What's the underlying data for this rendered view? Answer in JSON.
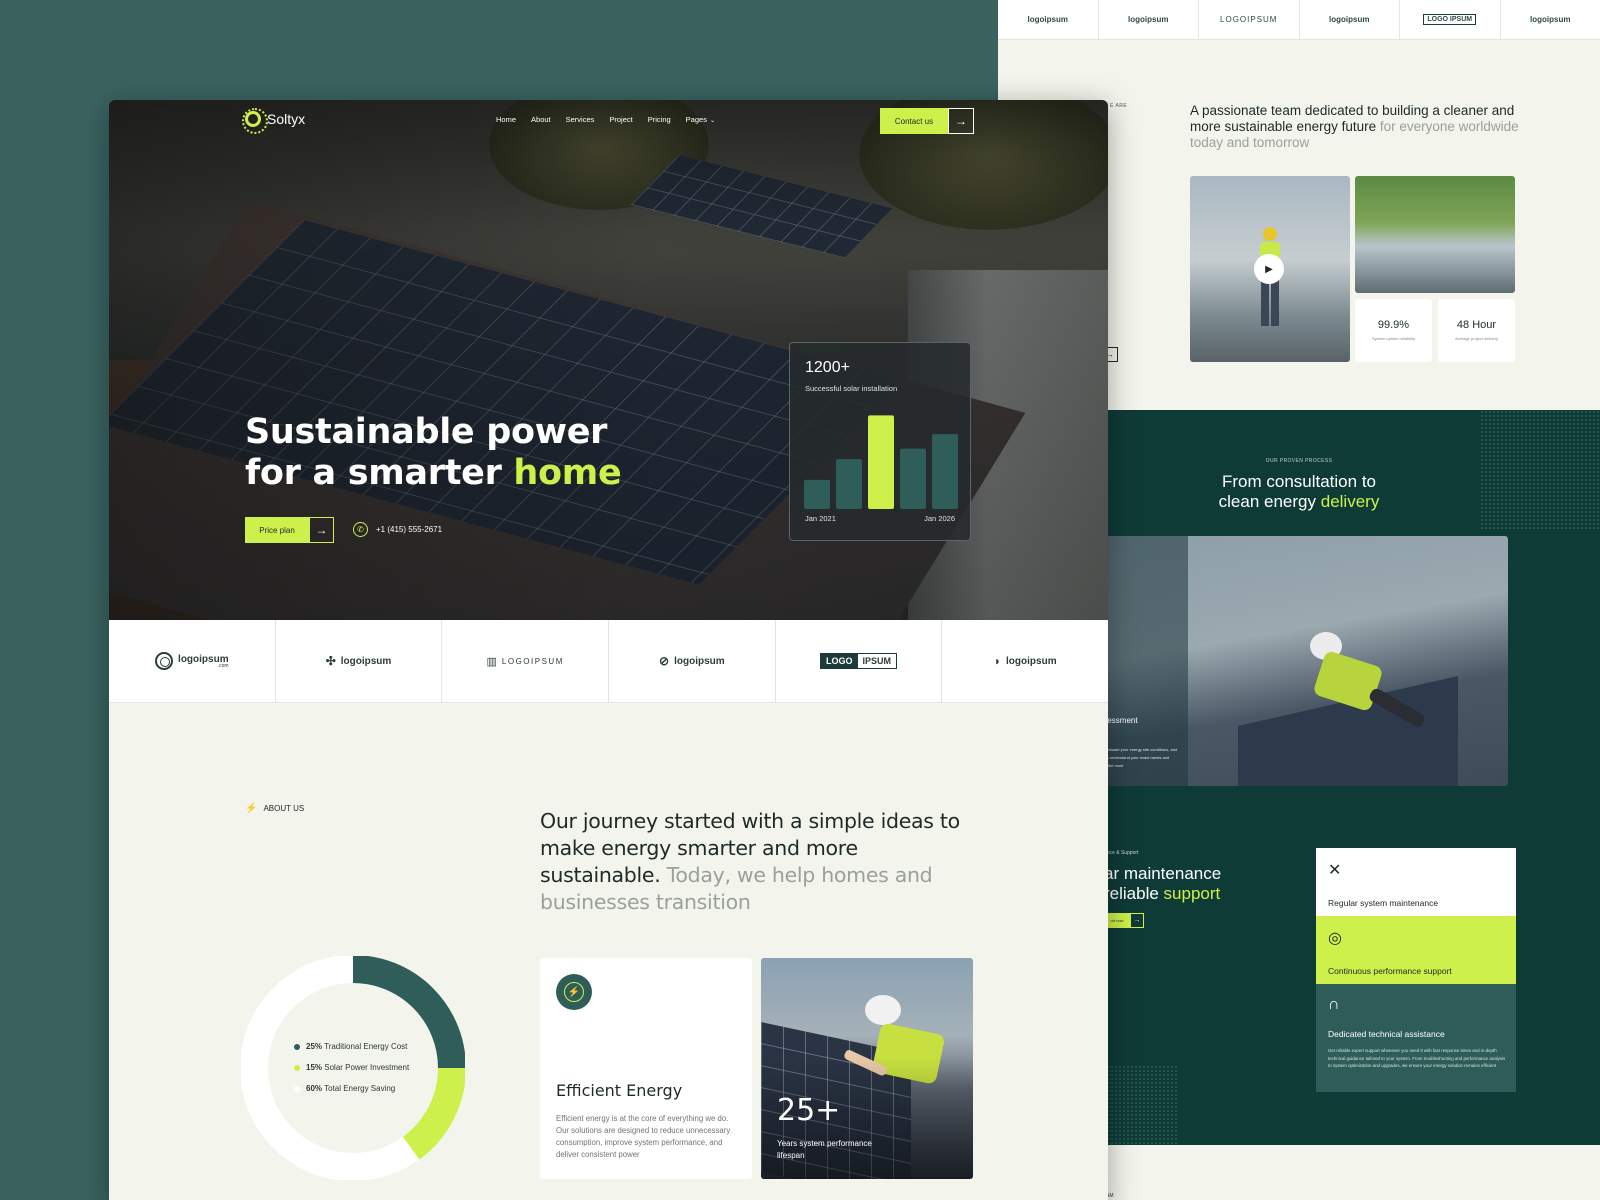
{
  "brand": {
    "name": "Soltyx",
    "accent": "#cdf04a",
    "primary_dark": "#0f3b37",
    "teal": "#2f5e5a"
  },
  "nav": {
    "items": [
      "Home",
      "About",
      "Services",
      "Project",
      "Pricing",
      "Pages"
    ],
    "contact_label": "Contact us"
  },
  "hero": {
    "title_line1": "Sustainable power",
    "title_line2_prefix": "for a smarter ",
    "title_highlight": "home",
    "price_button": "Price plan",
    "phone": "+1 (415) 555-2671"
  },
  "stat_card": {
    "value": "1200+",
    "label": "Successful solar installation",
    "start_label": "Jan 2021",
    "end_label": "Jan 2026"
  },
  "chart_data": {
    "type": "bar",
    "title": "1200+",
    "categories": [
      "1",
      "2",
      "3",
      "4",
      "5"
    ],
    "values": [
      28,
      48,
      90,
      58,
      72
    ],
    "ylim": [
      0,
      100
    ],
    "highlight_index": 2,
    "colors": {
      "bar": "#2f5e5a",
      "highlight": "#cdf04a"
    },
    "x_range_labels": [
      "Jan 2021",
      "Jan 2026"
    ]
  },
  "logos": [
    {
      "text": "logoipsum",
      "sub": ".com",
      "style": "ring"
    },
    {
      "text": "logoipsum",
      "sub": "",
      "style": "grid"
    },
    {
      "text": "LOGOIPSUM",
      "sub": "",
      "style": "thin"
    },
    {
      "text": "logoipsum",
      "sub": "",
      "style": "slash"
    },
    {
      "text": "LOGO",
      "text2": "IPSUM",
      "style": "boxed"
    },
    {
      "text": "logoipsum",
      "sub": "",
      "style": "d"
    }
  ],
  "about": {
    "caption": "ABOUT US",
    "text_strong": "Our journey started with a simple ideas to make energy smarter and more sustainable.",
    "text_muted": " Today, we help homes and businesses transition"
  },
  "donut": {
    "segments": [
      {
        "pct": "25%",
        "label": "Traditional Energy Cost",
        "value": 25,
        "color": "#2f5e5a"
      },
      {
        "pct": "15%",
        "label": "Solar Power Investment",
        "value": 15,
        "color": "#cdf04a"
      },
      {
        "pct": "60%",
        "label": "Total Energy Saving",
        "value": 60,
        "color": "#ffffff"
      }
    ]
  },
  "efficient_card": {
    "title": "Efficient Energy",
    "desc": "Efficient energy is at the core of everything we do. Our solutions are designed to reduce unnecessary consumption, improve system performance, and deliver consistent power"
  },
  "years_card": {
    "value": "25+",
    "caption": "Years system performance lifespan"
  },
  "bg_page": {
    "logos": [
      "logoipsum",
      "logoipsum",
      "LOGOIPSUM",
      "logoipsum",
      "LOGO IPSUM",
      "logoipsum"
    ],
    "side_caption": "E ARE",
    "team_heading_strong": "A passionate team dedicated to building a cleaner and more sustainable energy future",
    "team_heading_muted": " for everyone worldwide today and tomorrow",
    "stats": [
      {
        "value": "99.9%",
        "label": "System uptime reliability"
      },
      {
        "value": "48 Hour",
        "label": "Average project delivery"
      }
    ],
    "mini_btn": "ch",
    "process_caption": "OUR PROVEN PROCESS",
    "process_title_line1": "From consultation to",
    "process_title_line2_prefix": "clean energy ",
    "process_title_highlight": "delivery",
    "step_title": "rgy essment",
    "step_desc": "efully evaluate your energy site conditions, and future to understand your exact ments and identify the most",
    "support_caption": "ance & Support",
    "support_title_line1": "ar maintenance",
    "support_title_line2_prefix": " reliable ",
    "support_title_highlight": "support",
    "support_btn": "ort now",
    "services": [
      {
        "name": "Regular system maintenance",
        "icon": "tools-icon"
      },
      {
        "name": "Continuous performance support",
        "icon": "target-icon"
      },
      {
        "name": "Dedicated technical assistance",
        "icon": "headset-icon",
        "desc": "Get reliable expert support whenever you need it with fast response times and in-depth technical guidance tailored to your system. From troubleshooting and performance analysis to system optimization and upgrades, we ensure your energy solution remains efficient"
      }
    ],
    "bottom_caption": "AM"
  }
}
